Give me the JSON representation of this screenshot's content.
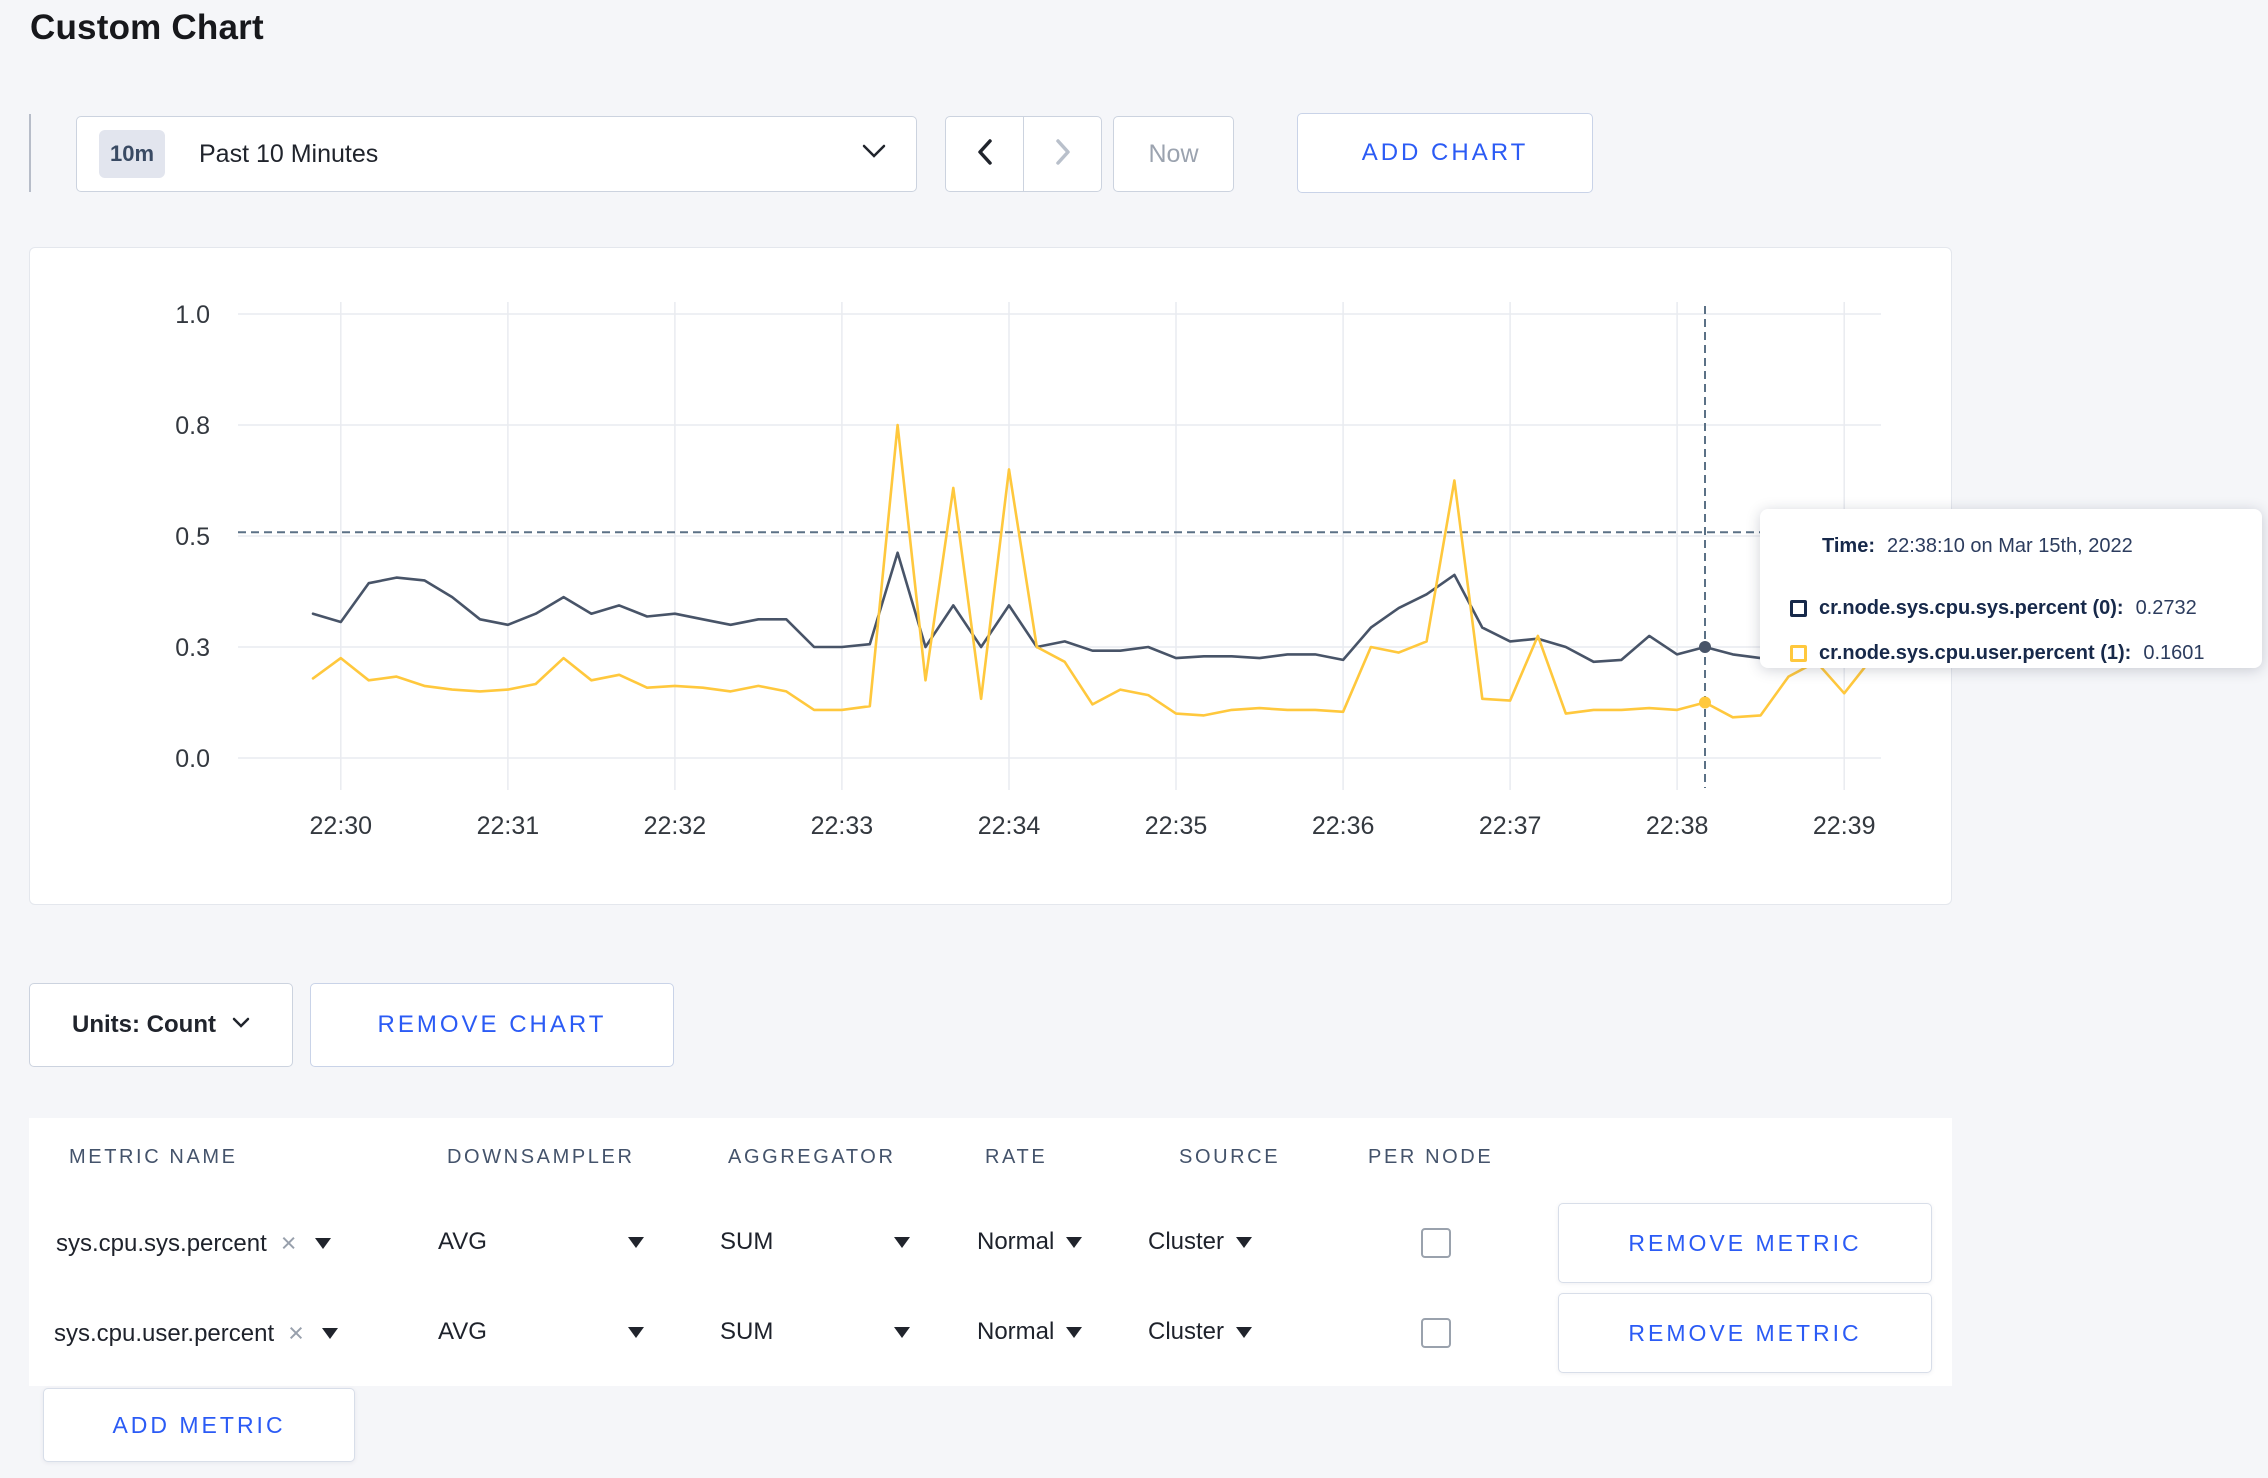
{
  "page": {
    "title": "Custom Chart"
  },
  "toolbar": {
    "time_range": {
      "badge": "10m",
      "label": "Past 10 Minutes"
    },
    "now_label": "Now",
    "add_chart_label": "ADD CHART"
  },
  "tooltip": {
    "time_label": "Time:",
    "time_value": "22:38:10 on Mar 15th, 2022",
    "series": [
      {
        "name": "cr.node.sys.cpu.sys.percent (0):",
        "value": "0.2732",
        "color": "#17294a"
      },
      {
        "name": "cr.node.sys.cpu.user.percent (1):",
        "value": "0.1601",
        "color": "#ffc83d"
      }
    ]
  },
  "chart_controls": {
    "units_label": "Units: Count",
    "remove_chart_label": "REMOVE CHART"
  },
  "metrics_table": {
    "headers": [
      "METRIC NAME",
      "DOWNSAMPLER",
      "AGGREGATOR",
      "RATE",
      "SOURCE",
      "PER NODE"
    ],
    "rows": [
      {
        "metric": "sys.cpu.sys.percent",
        "downsampler": "AVG",
        "aggregator": "SUM",
        "rate": "Normal",
        "source": "Cluster",
        "per_node_checked": false,
        "remove_label": "REMOVE METRIC"
      },
      {
        "metric": "sys.cpu.user.percent",
        "downsampler": "AVG",
        "aggregator": "SUM",
        "rate": "Normal",
        "source": "Cluster",
        "per_node_checked": false,
        "remove_label": "REMOVE METRIC"
      }
    ],
    "add_metric_label": "ADD METRIC"
  },
  "colors": {
    "accent_blue": "#2b5bf5",
    "series_sys": "#485468",
    "series_user": "#ffc83d",
    "crosshair": "#5b7186"
  },
  "chart_data": {
    "type": "line",
    "title": "",
    "xlabel": "",
    "ylabel": "",
    "x_ticks": [
      "22:30",
      "22:31",
      "22:32",
      "22:33",
      "22:34",
      "22:35",
      "22:36",
      "22:37",
      "22:38",
      "22:39"
    ],
    "y_ticks": [
      0.0,
      0.3,
      0.5,
      0.8,
      1.0
    ],
    "ylim": [
      0.0,
      1.0
    ],
    "grid": true,
    "x_start": "22:29:50",
    "x_interval_seconds": 10,
    "threshold_line": 0.51,
    "crosshair": {
      "time": "22:38:10",
      "index": 50
    },
    "series": [
      {
        "name": "cr.node.sys.cpu.sys.percent",
        "color": "#485468",
        "values": [
          0.36,
          0.345,
          0.415,
          0.425,
          0.42,
          0.39,
          0.35,
          0.34,
          0.36,
          0.39,
          0.36,
          0.375,
          0.355,
          0.36,
          0.35,
          0.34,
          0.35,
          0.35,
          0.3,
          0.3,
          0.305,
          0.47,
          0.3,
          0.375,
          0.3,
          0.375,
          0.3,
          0.31,
          0.29,
          0.29,
          0.3,
          0.27,
          0.275,
          0.275,
          0.27,
          0.28,
          0.28,
          0.265,
          0.335,
          0.37,
          0.395,
          0.43,
          0.335,
          0.31,
          0.315,
          0.3,
          0.26,
          0.265,
          0.32,
          0.28,
          0.3,
          0.28,
          0.27,
          0.28,
          0.3,
          0.29,
          0.3
        ]
      },
      {
        "name": "cr.node.sys.cpu.user.percent",
        "color": "#ffc83d",
        "values": [
          0.215,
          0.27,
          0.21,
          0.22,
          0.195,
          0.185,
          0.18,
          0.185,
          0.2,
          0.27,
          0.21,
          0.225,
          0.19,
          0.195,
          0.19,
          0.18,
          0.195,
          0.18,
          0.13,
          0.13,
          0.14,
          0.8,
          0.21,
          0.63,
          0.16,
          0.68,
          0.3,
          0.26,
          0.145,
          0.185,
          0.17,
          0.12,
          0.115,
          0.13,
          0.135,
          0.13,
          0.13,
          0.125,
          0.3,
          0.285,
          0.31,
          0.65,
          0.16,
          0.155,
          0.32,
          0.12,
          0.13,
          0.13,
          0.135,
          0.13,
          0.15,
          0.11,
          0.115,
          0.22,
          0.26,
          0.175,
          0.27
        ]
      }
    ]
  }
}
